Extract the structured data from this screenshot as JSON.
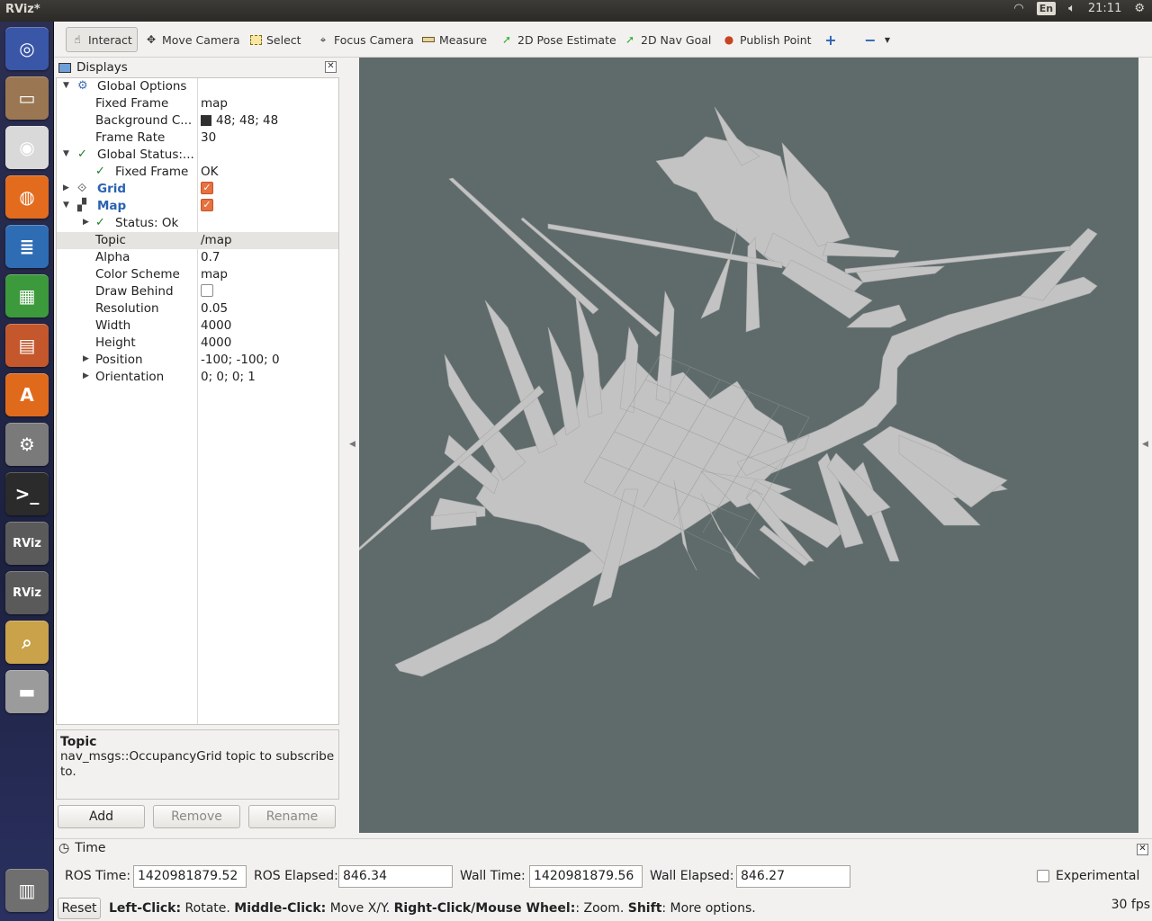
{
  "window": {
    "title": "RViz*"
  },
  "tray": {
    "lang": "En",
    "clock": "21:11"
  },
  "launcher": {
    "items": [
      {
        "name": "ubuntu-dash-icon",
        "color": "#3a56a7",
        "glyph": "◎"
      },
      {
        "name": "files-icon",
        "color": "#9a7752",
        "glyph": "▭"
      },
      {
        "name": "chrome-icon",
        "color": "#d9d9d9",
        "glyph": "◉"
      },
      {
        "name": "firefox-icon",
        "color": "#e26b1d",
        "glyph": "◍"
      },
      {
        "name": "writer-icon",
        "color": "#2e6db4",
        "glyph": "≣"
      },
      {
        "name": "calc-icon",
        "color": "#3c9a3c",
        "glyph": "▦"
      },
      {
        "name": "impress-icon",
        "color": "#c4572b",
        "glyph": "▤"
      },
      {
        "name": "software-center-icon",
        "color": "#e06a1c",
        "glyph": "A"
      },
      {
        "name": "settings-icon",
        "color": "#7a7a7a",
        "glyph": "⚙"
      },
      {
        "name": "terminal-icon",
        "color": "#2b2b2b",
        "glyph": ">_"
      },
      {
        "name": "rviz-icon",
        "color": "#5a5a5a",
        "glyph": "RViz"
      },
      {
        "name": "rviz-icon",
        "color": "#5a5a5a",
        "glyph": "RViz"
      },
      {
        "name": "image-viewer-icon",
        "color": "#c9a24a",
        "glyph": "⌕"
      },
      {
        "name": "disk-icon",
        "color": "#9b9b9b",
        "glyph": "▬"
      },
      {
        "name": "trash-icon",
        "color": "#6f6f6f",
        "glyph": "▥"
      }
    ]
  },
  "toolbar": {
    "interact": "Interact",
    "move_camera": "Move Camera",
    "select": "Select",
    "focus_camera": "Focus Camera",
    "measure": "Measure",
    "pose_estimate": "2D Pose Estimate",
    "nav_goal": "2D Nav Goal",
    "publish_point": "Publish Point"
  },
  "displays": {
    "title": "Displays",
    "close": "✕",
    "rows": {
      "global_options": "Global Options",
      "fixed_frame_key": "Fixed Frame",
      "fixed_frame_val": "map",
      "background_key": "Background C...",
      "background_val": "48; 48; 48",
      "frame_rate_key": "Frame Rate",
      "frame_rate_val": "30",
      "global_status": "Global Status:...",
      "status_fixed_frame_key": "Fixed Frame",
      "status_fixed_frame_val": "OK",
      "grid": "Grid",
      "map": "Map",
      "status_ok": "Status: Ok",
      "topic_key": "Topic",
      "topic_val": "/map",
      "alpha_key": "Alpha",
      "alpha_val": "0.7",
      "color_scheme_key": "Color Scheme",
      "color_scheme_val": "map",
      "draw_behind_key": "Draw Behind",
      "resolution_key": "Resolution",
      "resolution_val": "0.05",
      "width_key": "Width",
      "width_val": "4000",
      "height_key": "Height",
      "height_val": "4000",
      "position_key": "Position",
      "position_val": "-100; -100; 0",
      "orientation_key": "Orientation",
      "orientation_val": "0; 0; 0; 1"
    },
    "help": {
      "title": "Topic",
      "body": "nav_msgs::OccupancyGrid topic to subscribe to."
    },
    "buttons": {
      "add": "Add",
      "remove": "Remove",
      "rename": "Rename"
    }
  },
  "time": {
    "title": "Time",
    "close": "✕",
    "ros_time_label": "ROS Time:",
    "ros_time": "1420981879.52",
    "ros_elapsed_label": "ROS Elapsed:",
    "ros_elapsed": "846.34",
    "wall_time_label": "Wall Time:",
    "wall_time": "1420981879.56",
    "wall_elapsed_label": "Wall Elapsed:",
    "wall_elapsed": "846.27",
    "experimental": "Experimental"
  },
  "status": {
    "reset": "Reset",
    "left_click": "Left-Click:",
    "rotate": " Rotate. ",
    "middle_click": "Middle-Click:",
    "move": " Move X/Y. ",
    "right_click": "Right-Click/Mouse Wheel:",
    "zoom": ": Zoom. ",
    "shift": "Shift",
    "more": ": More options.",
    "fps": "30 fps"
  },
  "colors": {
    "view_background": "#5f6b6b",
    "map_free": "#c3c3c3",
    "checkbox_accent": "#e7713f"
  }
}
